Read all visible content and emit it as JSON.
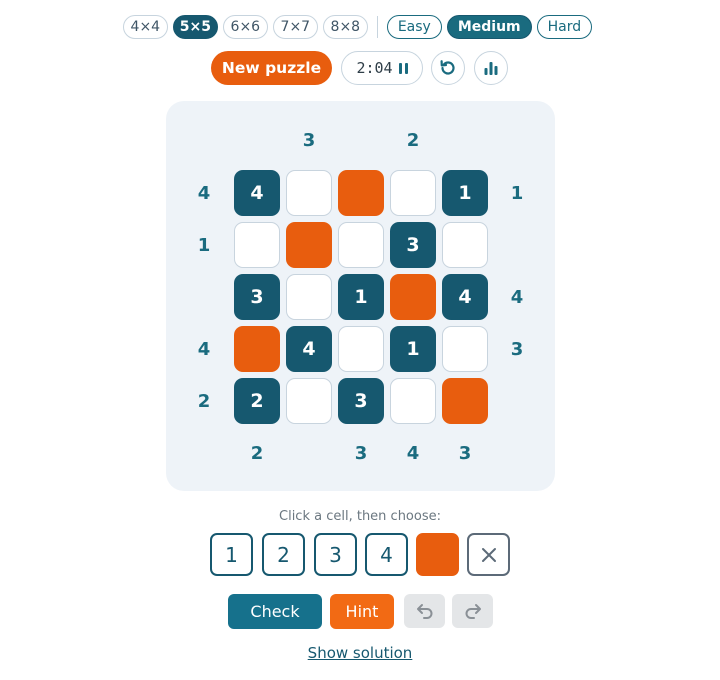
{
  "sizes": [
    "4×4",
    "5×5",
    "6×6",
    "7×7",
    "8×8"
  ],
  "active_size": "5×5",
  "difficulties": [
    "Easy",
    "Medium",
    "Hard"
  ],
  "active_difficulty": "Medium",
  "new_puzzle_label": "New puzzle",
  "timer": "2:04",
  "clues": {
    "top": [
      "",
      "3",
      "",
      "2",
      ""
    ],
    "bottom": [
      "2",
      "",
      "3",
      "4",
      "3"
    ],
    "left": [
      "4",
      "1",
      "",
      "4",
      "2"
    ],
    "right": [
      "1",
      "",
      "4",
      "3",
      ""
    ]
  },
  "grid": [
    [
      "4",
      "",
      "B",
      "",
      "1"
    ],
    [
      "",
      "B",
      "",
      "3",
      ""
    ],
    [
      "3",
      "",
      "1",
      "B",
      "4"
    ],
    [
      "B",
      "4",
      "",
      "1",
      ""
    ],
    [
      "2",
      "",
      "3",
      "",
      "B"
    ]
  ],
  "prompt": "Click a cell, then choose:",
  "palette": [
    "1",
    "2",
    "3",
    "4"
  ],
  "check_label": "Check",
  "hint_label": "Hint",
  "show_solution_label": "Show solution",
  "colors": {
    "teal": "#16586f",
    "orange": "#e85d0e",
    "board_bg": "#eef3f8"
  }
}
